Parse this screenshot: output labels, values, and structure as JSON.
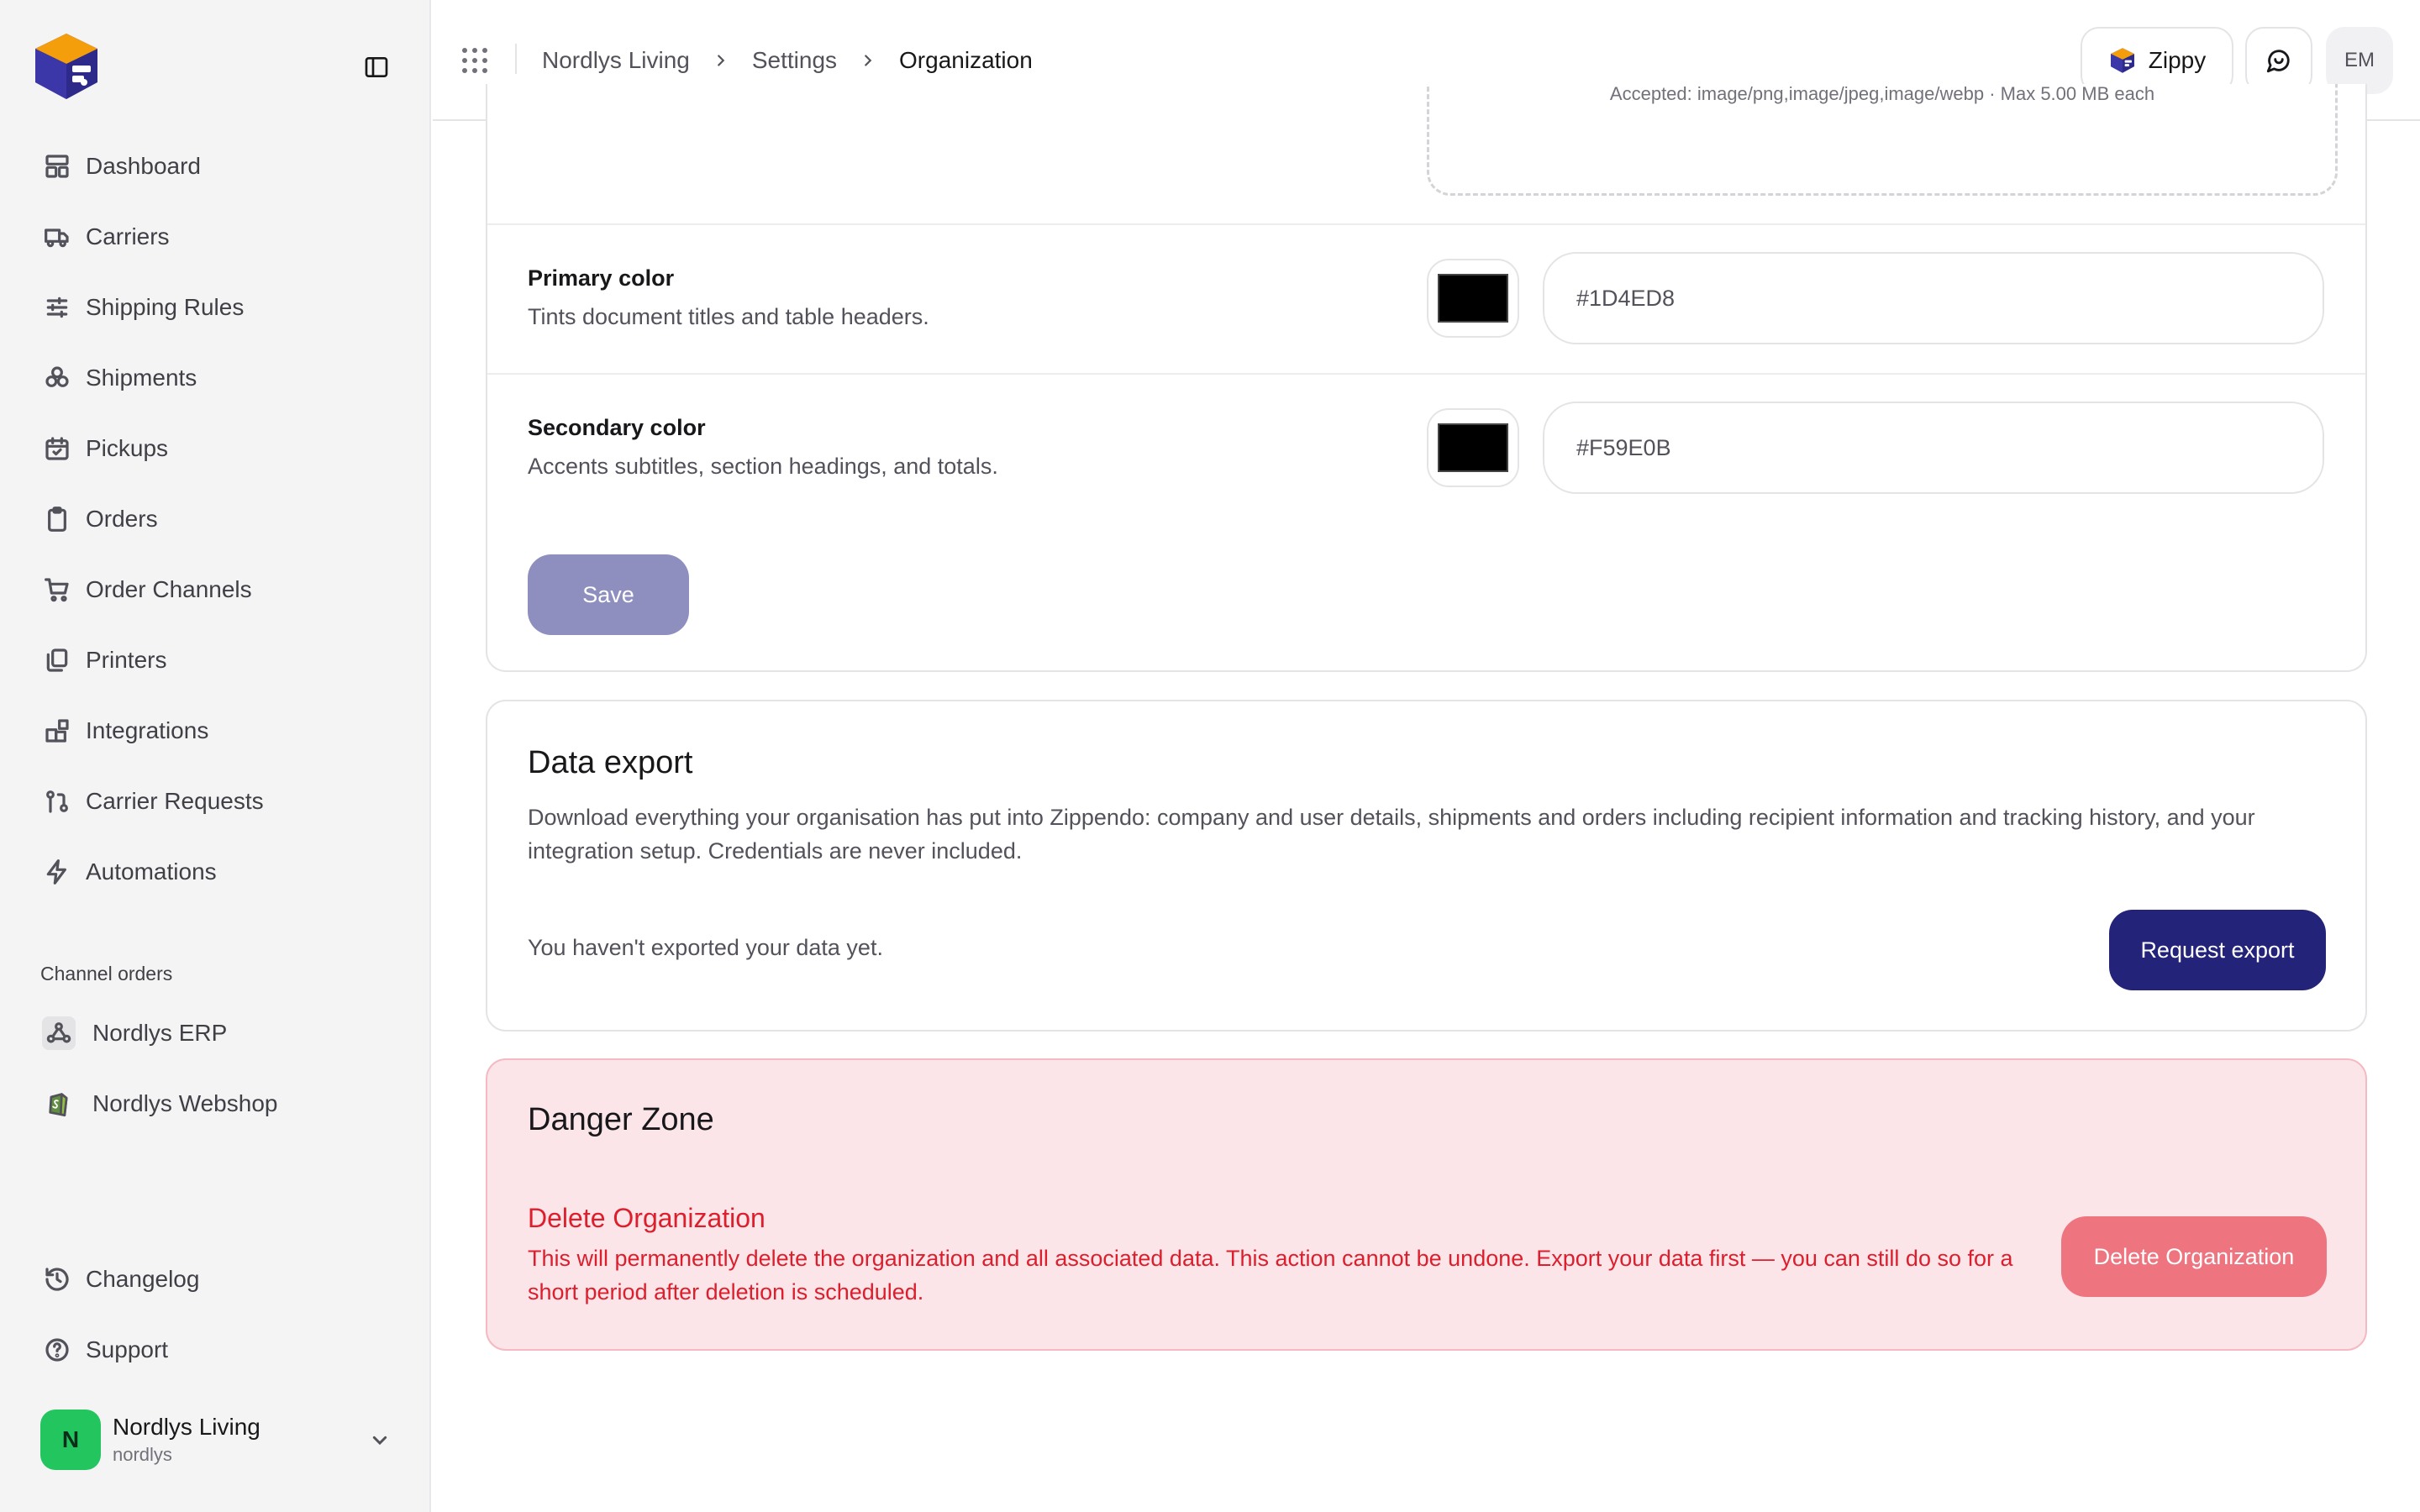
{
  "sidebar": {
    "items": [
      {
        "label": "Dashboard",
        "icon": "dashboard-icon"
      },
      {
        "label": "Carriers",
        "icon": "truck-icon"
      },
      {
        "label": "Shipping Rules",
        "icon": "sliders-icon"
      },
      {
        "label": "Shipments",
        "icon": "boxes-icon"
      },
      {
        "label": "Pickups",
        "icon": "calendar-check-icon"
      },
      {
        "label": "Orders",
        "icon": "clipboard-icon"
      },
      {
        "label": "Order Channels",
        "icon": "cart-icon"
      },
      {
        "label": "Printers",
        "icon": "printer-icon"
      },
      {
        "label": "Integrations",
        "icon": "blocks-icon"
      },
      {
        "label": "Carrier Requests",
        "icon": "git-pull-request-icon"
      },
      {
        "label": "Automations",
        "icon": "zap-icon"
      }
    ],
    "section_label": "Channel orders",
    "channels": [
      {
        "label": "Nordlys ERP",
        "icon": "webhook-icon"
      },
      {
        "label": "Nordlys Webshop",
        "icon": "shopify-icon"
      }
    ],
    "bottom": [
      {
        "label": "Changelog",
        "icon": "history-icon"
      },
      {
        "label": "Support",
        "icon": "help-circle-icon"
      }
    ],
    "org": {
      "initial": "N",
      "name": "Nordlys Living",
      "slug": "nordlys"
    }
  },
  "topbar": {
    "breadcrumbs": [
      "Nordlys Living",
      "Settings",
      "Organization"
    ],
    "assistant_label": "Zippy",
    "user_initials": "EM"
  },
  "branding": {
    "upload_hint": "Accepted: image/png,image/jpeg,image/webp · Max 5.00 MB each",
    "primary": {
      "label": "Primary color",
      "description": "Tints document titles and table headers.",
      "value": "#1D4ED8"
    },
    "secondary": {
      "label": "Secondary color",
      "description": "Accents subtitles, section headings, and totals.",
      "value": "#F59E0B"
    },
    "save_label": "Save"
  },
  "data_export": {
    "title": "Data export",
    "description": "Download everything your organisation has put into Zippendo: company and user details, shipments and orders including recipient information and tracking history, and your integration setup. Credentials are never included.",
    "status": "You haven't exported your data yet.",
    "button_label": "Request export"
  },
  "danger_zone": {
    "title": "Danger Zone",
    "subtitle": "Delete Organization",
    "description": "This will permanently delete the organization and all associated data. This action cannot be undone. Export your data first — you can still do so for a short period after deletion is scheduled.",
    "button_label": "Delete Organization"
  },
  "colors": {
    "accent": "#24237a",
    "danger": "#dc1e2d",
    "danger_button": "#ee7580",
    "save_disabled": "#8e8fbf",
    "org_avatar": "#22c55e"
  }
}
